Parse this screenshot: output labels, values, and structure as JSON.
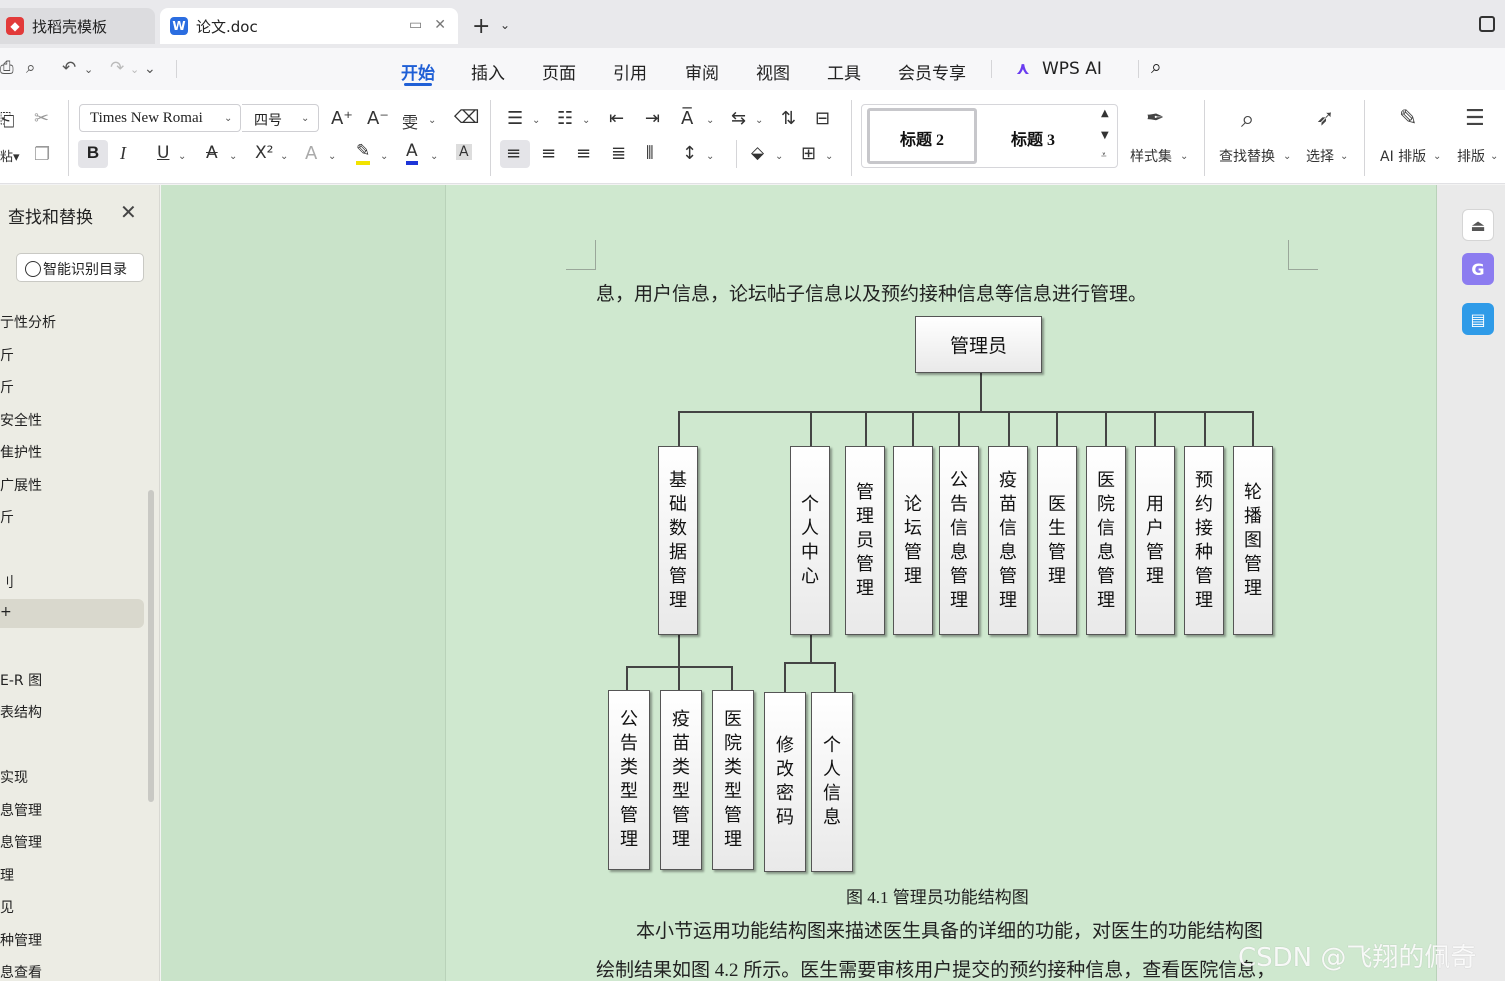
{
  "tabs": {
    "inactive_label": "找稻壳模板",
    "active_label": "论文.doc",
    "active_icon_letter": "W"
  },
  "menu": {
    "items": [
      "开始",
      "插入",
      "页面",
      "引用",
      "审阅",
      "视图",
      "工具",
      "会员专享",
      "WPS AI"
    ],
    "active": "开始"
  },
  "ribbon": {
    "font_name": "Times New Romai",
    "font_size": "四号",
    "style_h2": "标题 2",
    "style_h3": "标题 3",
    "styles_label": "样式集",
    "find_replace_label": "查找替换",
    "select_label": "选择",
    "ai_layout_label": "AI 排版",
    "layout_label": "排版",
    "paste_label": "粘贴"
  },
  "left_panel": {
    "title": "查找和替换",
    "smart_toc_button": "智能识别目录",
    "toc_items": [
      "亍性分析",
      "斤",
      "斤",
      "安全性",
      "隹护性",
      "广展性",
      "斤",
      "刂",
      "+",
      "E-R 图",
      "表结构",
      "实现",
      "息管理",
      "息管理",
      "理",
      "见",
      "种管理",
      "息查看"
    ]
  },
  "document": {
    "line1": "息，用户信息，论坛帖子信息以及预约接种信息等信息进行管理。",
    "figure_caption": "图 4.1  管理员功能结构图",
    "para1": "本小节运用功能结构图来描述医生具备的详细的功能，对医生的功能结构图",
    "para2": "绘制结果如图 4.2 所示。医生需要审核用户提交的预约接种信息，查看医院信息，"
  },
  "org_chart": {
    "root": "管理员",
    "level1": [
      "基础数据管理",
      "个人中心",
      "管理员管理",
      "论坛管理",
      "公告信息管理",
      "疫苗信息管理",
      "医生管理",
      "医院信息管理",
      "用户管理",
      "预约接种管理",
      "轮播图管理"
    ],
    "base_data_children": [
      "公告类型管理",
      "疫苗类型管理",
      "医院类型管理"
    ],
    "personal_center_children": [
      "修改密码",
      "个人信息"
    ]
  },
  "watermark": "CSDN @飞翔的佩奇"
}
